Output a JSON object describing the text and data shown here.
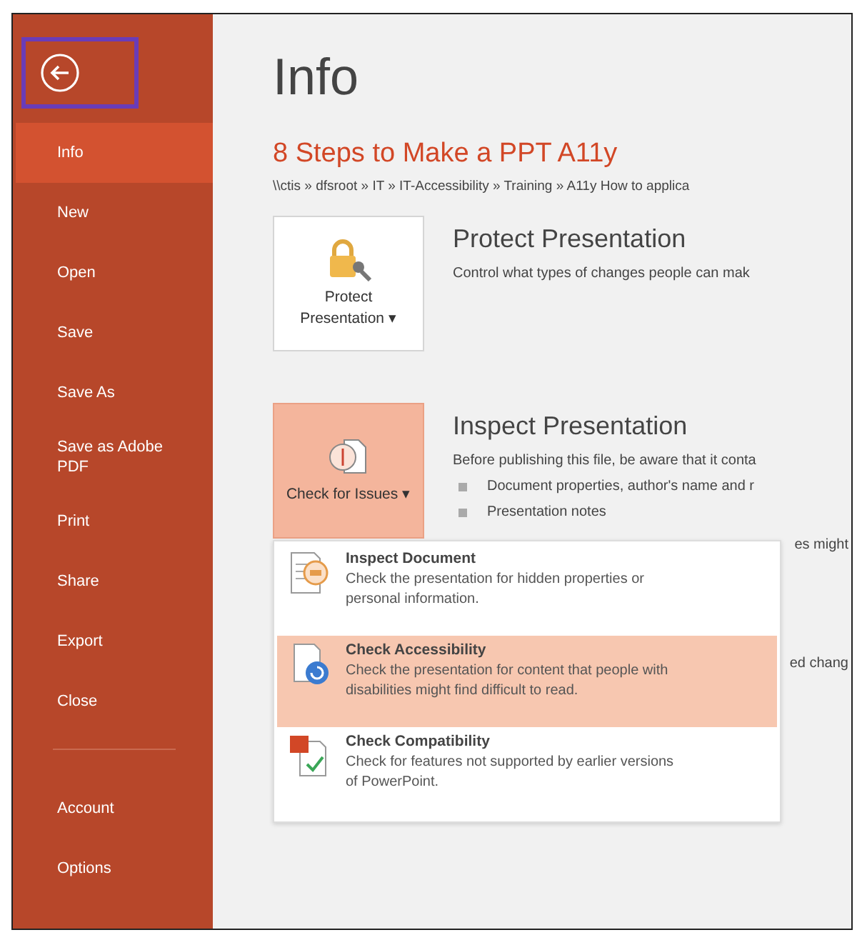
{
  "sidebar": {
    "items": [
      {
        "label": "Info",
        "selected": true
      },
      {
        "label": "New",
        "selected": false
      },
      {
        "label": "Open",
        "selected": false
      },
      {
        "label": "Save",
        "selected": false
      },
      {
        "label": "Save As",
        "selected": false
      },
      {
        "label": "Save as Adobe PDF",
        "selected": false
      },
      {
        "label": "Print",
        "selected": false
      },
      {
        "label": "Share",
        "selected": false
      },
      {
        "label": "Export",
        "selected": false
      },
      {
        "label": "Close",
        "selected": false
      }
    ],
    "bottom_items": [
      {
        "label": "Account",
        "selected": false
      },
      {
        "label": "Options",
        "selected": false
      }
    ]
  },
  "page_title": "Info",
  "document": {
    "title": "8 Steps to Make a PPT A11y",
    "path": "\\\\ctis » dfsroot » IT » IT-Accessibility » Training » A11y How to applica"
  },
  "protect": {
    "button": "Protect Presentation ▾",
    "heading": "Protect Presentation",
    "description": "Control what types of changes people can mak"
  },
  "inspect": {
    "button": "Check for Issues ▾",
    "pressed": true,
    "heading": "Inspect Presentation",
    "description": "Before publishing this file, be aware that it conta",
    "bullets": [
      "Document properties, author's name and r",
      "Presentation notes"
    ],
    "hidden_fragments": [
      "es might",
      "ed chang"
    ]
  },
  "menu": {
    "items": [
      {
        "kind": "inspect",
        "title": "Inspect Document",
        "description": "Check the presentation for hidden properties or personal information.",
        "selected": false
      },
      {
        "kind": "accessibility",
        "title": "Check Accessibility",
        "description": "Check the presentation for content that people with disabilities might find difficult to read.",
        "selected": true
      },
      {
        "kind": "compatibility",
        "title": "Check Compatibility",
        "description": "Check for features not supported by earlier versions of PowerPoint.",
        "selected": false
      }
    ]
  }
}
